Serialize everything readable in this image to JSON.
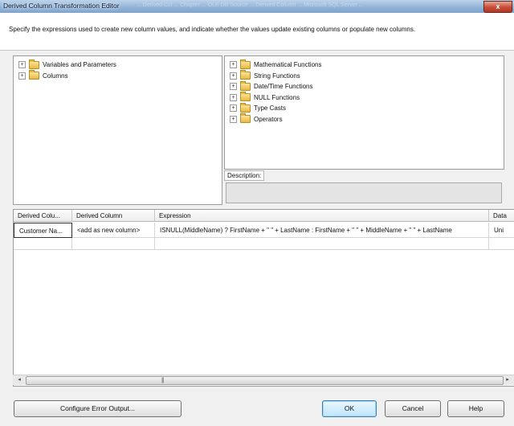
{
  "window": {
    "title": "Derived Column Transformation Editor",
    "background_text": "... Derived Col ... Chapter ... OLE DB Source ... Derived Column ... Microsoft SQL Server ...",
    "close_glyph": "x"
  },
  "header": {
    "description": "Specify the expressions used to create new column values, and indicate whether the values update existing columns or populate new columns."
  },
  "left_tree": {
    "items": [
      {
        "label": "Variables and Parameters",
        "icon": "folder-icon"
      },
      {
        "label": "Columns",
        "icon": "folder-icon"
      }
    ]
  },
  "right_tree": {
    "items": [
      {
        "label": "Mathematical Functions",
        "icon": "folder-icon"
      },
      {
        "label": "String Functions",
        "icon": "folder-icon"
      },
      {
        "label": "Date/Time Functions",
        "icon": "folder-icon"
      },
      {
        "label": "NULL Functions",
        "icon": "folder-icon"
      },
      {
        "label": "Type Casts",
        "icon": "folder-icon"
      },
      {
        "label": "Operators",
        "icon": "folder-icon"
      }
    ]
  },
  "description_panel": {
    "label": "Description:",
    "value": ""
  },
  "grid": {
    "columns": [
      "Derived Colu...",
      "Derived Column",
      "Expression",
      "Data"
    ],
    "rows": [
      [
        "Customer Na...",
        "<add as new column>",
        "ISNULL(MiddleName) ? FirstName + \" \" + LastName : FirstName + \" \" + MiddleName + \" \" + LastName",
        "Uni"
      ]
    ]
  },
  "scrollbar": {
    "left_arrow": "◂",
    "right_arrow": "▸",
    "grip": "|||"
  },
  "buttons": {
    "configure_error": "Configure Error Output...",
    "ok": "OK",
    "cancel": "Cancel",
    "help": "Help"
  }
}
